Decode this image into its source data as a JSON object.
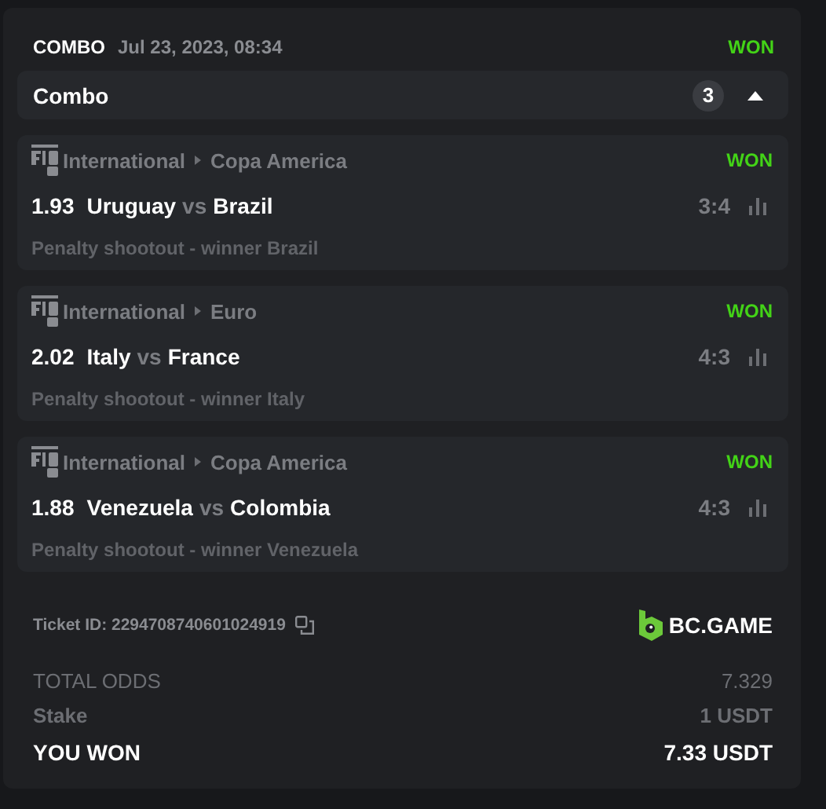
{
  "ticket": {
    "type": "COMBO",
    "date": "Jul 23, 2023, 08:34",
    "status": "WON"
  },
  "combo": {
    "title": "Combo",
    "count": "3",
    "expanded": true
  },
  "bets": [
    {
      "category": "International",
      "league": "Copa America",
      "status": "WON",
      "odds": "1.93",
      "home": "Uruguay",
      "vs": "vs",
      "away": "Brazil",
      "score": "3:4",
      "market": "Penalty shootout - winner Brazil"
    },
    {
      "category": "International",
      "league": "Euro",
      "status": "WON",
      "odds": "2.02",
      "home": "Italy",
      "vs": "vs",
      "away": "France",
      "score": "4:3",
      "market": "Penalty shootout - winner Italy"
    },
    {
      "category": "International",
      "league": "Copa America",
      "status": "WON",
      "odds": "1.88",
      "home": "Venezuela",
      "vs": "vs",
      "away": "Colombia",
      "score": "4:3",
      "market": "Penalty shootout - winner Venezuela"
    }
  ],
  "ticket_id": "Ticket ID: 2294708740601024919",
  "brand": "BC.GAME",
  "totals": [
    {
      "kind": "muted",
      "label": "TOTAL ODDS",
      "value": "7.329"
    },
    {
      "kind": "plain",
      "label": "Stake",
      "value": "1 USDT"
    },
    {
      "kind": "strong",
      "label": "YOU WON",
      "value": "7.33 USDT"
    }
  ]
}
